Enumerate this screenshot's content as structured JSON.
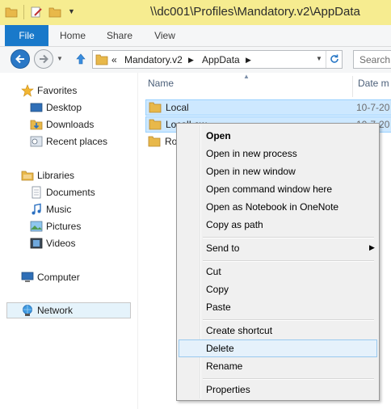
{
  "window": {
    "title": "\\\\dc001\\Profiles\\Mandatory.v2\\AppData"
  },
  "ribbon": {
    "tabs": [
      "File",
      "Home",
      "Share",
      "View"
    ]
  },
  "address": {
    "prefix": "«",
    "crumbs": [
      "Mandatory.v2",
      "AppData"
    ],
    "search_placeholder": "Search A"
  },
  "nav": {
    "favorites": {
      "label": "Favorites",
      "items": [
        "Desktop",
        "Downloads",
        "Recent places"
      ]
    },
    "libraries": {
      "label": "Libraries",
      "items": [
        "Documents",
        "Music",
        "Pictures",
        "Videos"
      ]
    },
    "computer": "Computer",
    "network": "Network"
  },
  "filelist": {
    "columns": {
      "name": "Name",
      "date": "Date m"
    },
    "rows": [
      {
        "name": "Local",
        "date": "10-7-20",
        "selected": true
      },
      {
        "name": "LocalLow",
        "date": "10-7-20",
        "selected": true
      },
      {
        "name": "Roaming",
        "date": "",
        "selected": false
      }
    ]
  },
  "context_menu": {
    "items": [
      {
        "label": "Open",
        "bold": true
      },
      {
        "label": "Open in new process"
      },
      {
        "label": "Open in new window"
      },
      {
        "label": "Open command window here"
      },
      {
        "label": "Open as Notebook in OneNote"
      },
      {
        "label": "Copy as path"
      },
      {
        "label": "Send to",
        "submenu": true
      },
      {
        "label": "Cut"
      },
      {
        "label": "Copy"
      },
      {
        "label": "Paste"
      },
      {
        "label": "Create shortcut"
      },
      {
        "label": "Delete",
        "hovered": true
      },
      {
        "label": "Rename"
      },
      {
        "label": "Properties"
      }
    ]
  },
  "colors": {
    "titlebar": "#f6ec90",
    "file_tab": "#1979ca",
    "selection": "#cde8ff",
    "menu_hover": "#e5f1fb"
  }
}
